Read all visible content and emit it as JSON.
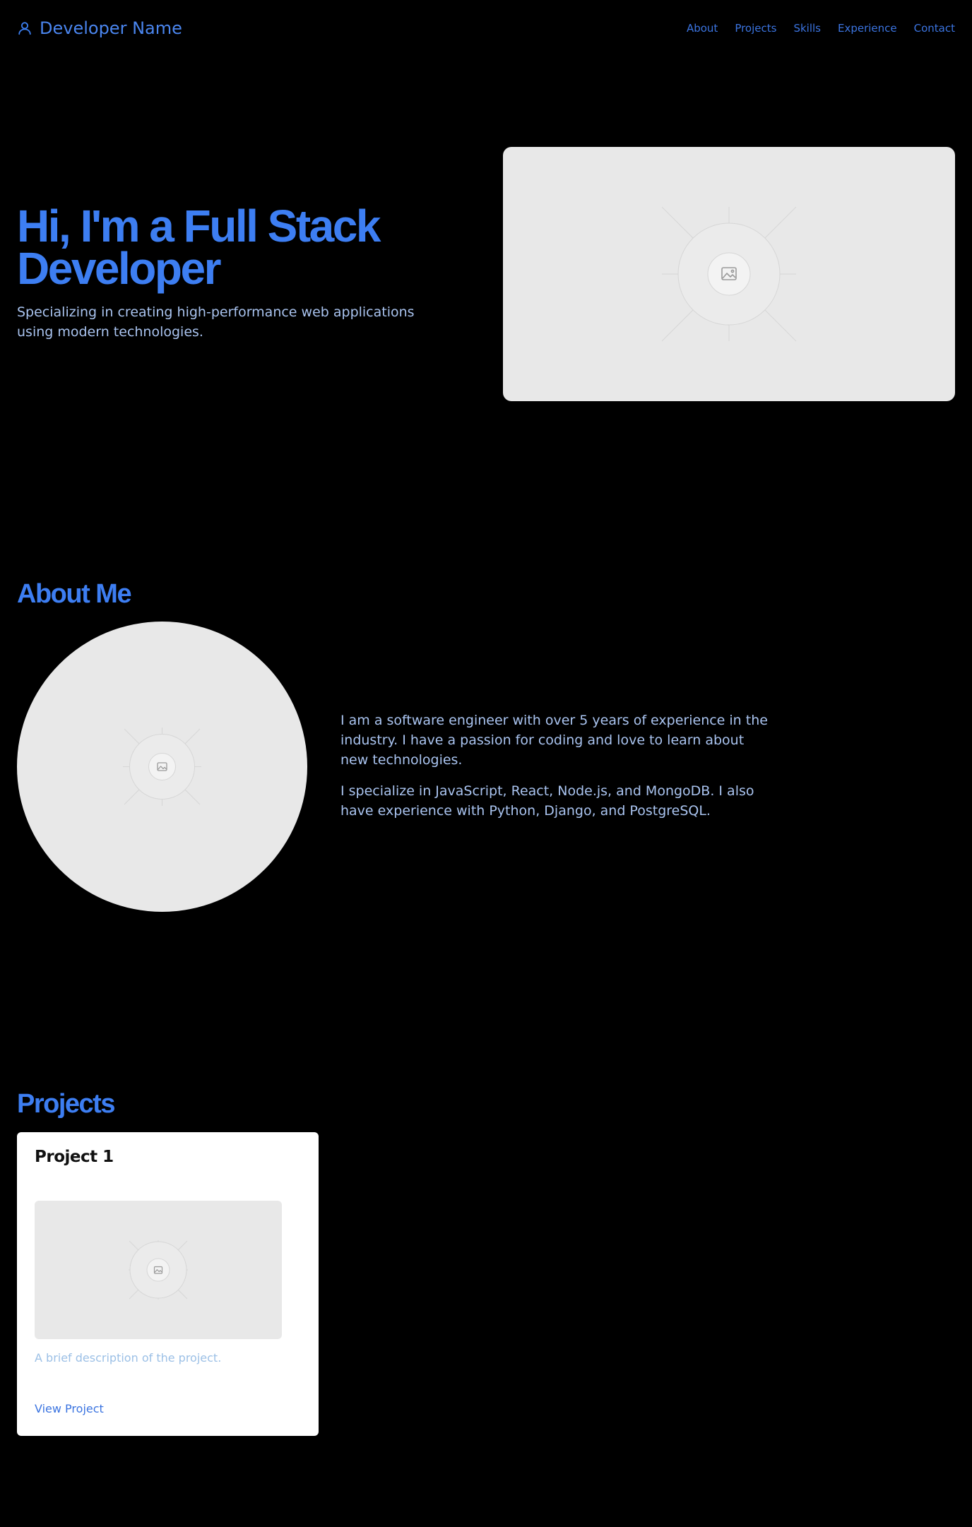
{
  "header": {
    "brand_name": "Developer Name",
    "brand_icon": "user-icon",
    "nav": [
      "About",
      "Projects",
      "Skills",
      "Experience",
      "Contact"
    ]
  },
  "hero": {
    "title": "Hi, I'm a Full Stack Developer",
    "subtitle": "Specializing in creating high-performance web applications using modern technologies.",
    "image_icon": "image-placeholder-icon"
  },
  "about": {
    "title": "About Me",
    "paragraphs": [
      "I am a software engineer with over 5 years of experience in the industry. I have a passion for coding and love to learn about new technologies.",
      "I specialize in JavaScript, React, Node.js, and MongoDB. I also have experience with Python, Django, and PostgreSQL."
    ]
  },
  "projects": {
    "title": "Projects",
    "items": [
      {
        "name": "Project 1",
        "description": "A brief description of the project.",
        "link_label": "View Project"
      }
    ]
  },
  "colors": {
    "background": "#000000",
    "accent": "#3d7ef2",
    "body_text": "#a9c3ef",
    "placeholder": "#e8e8e8"
  }
}
